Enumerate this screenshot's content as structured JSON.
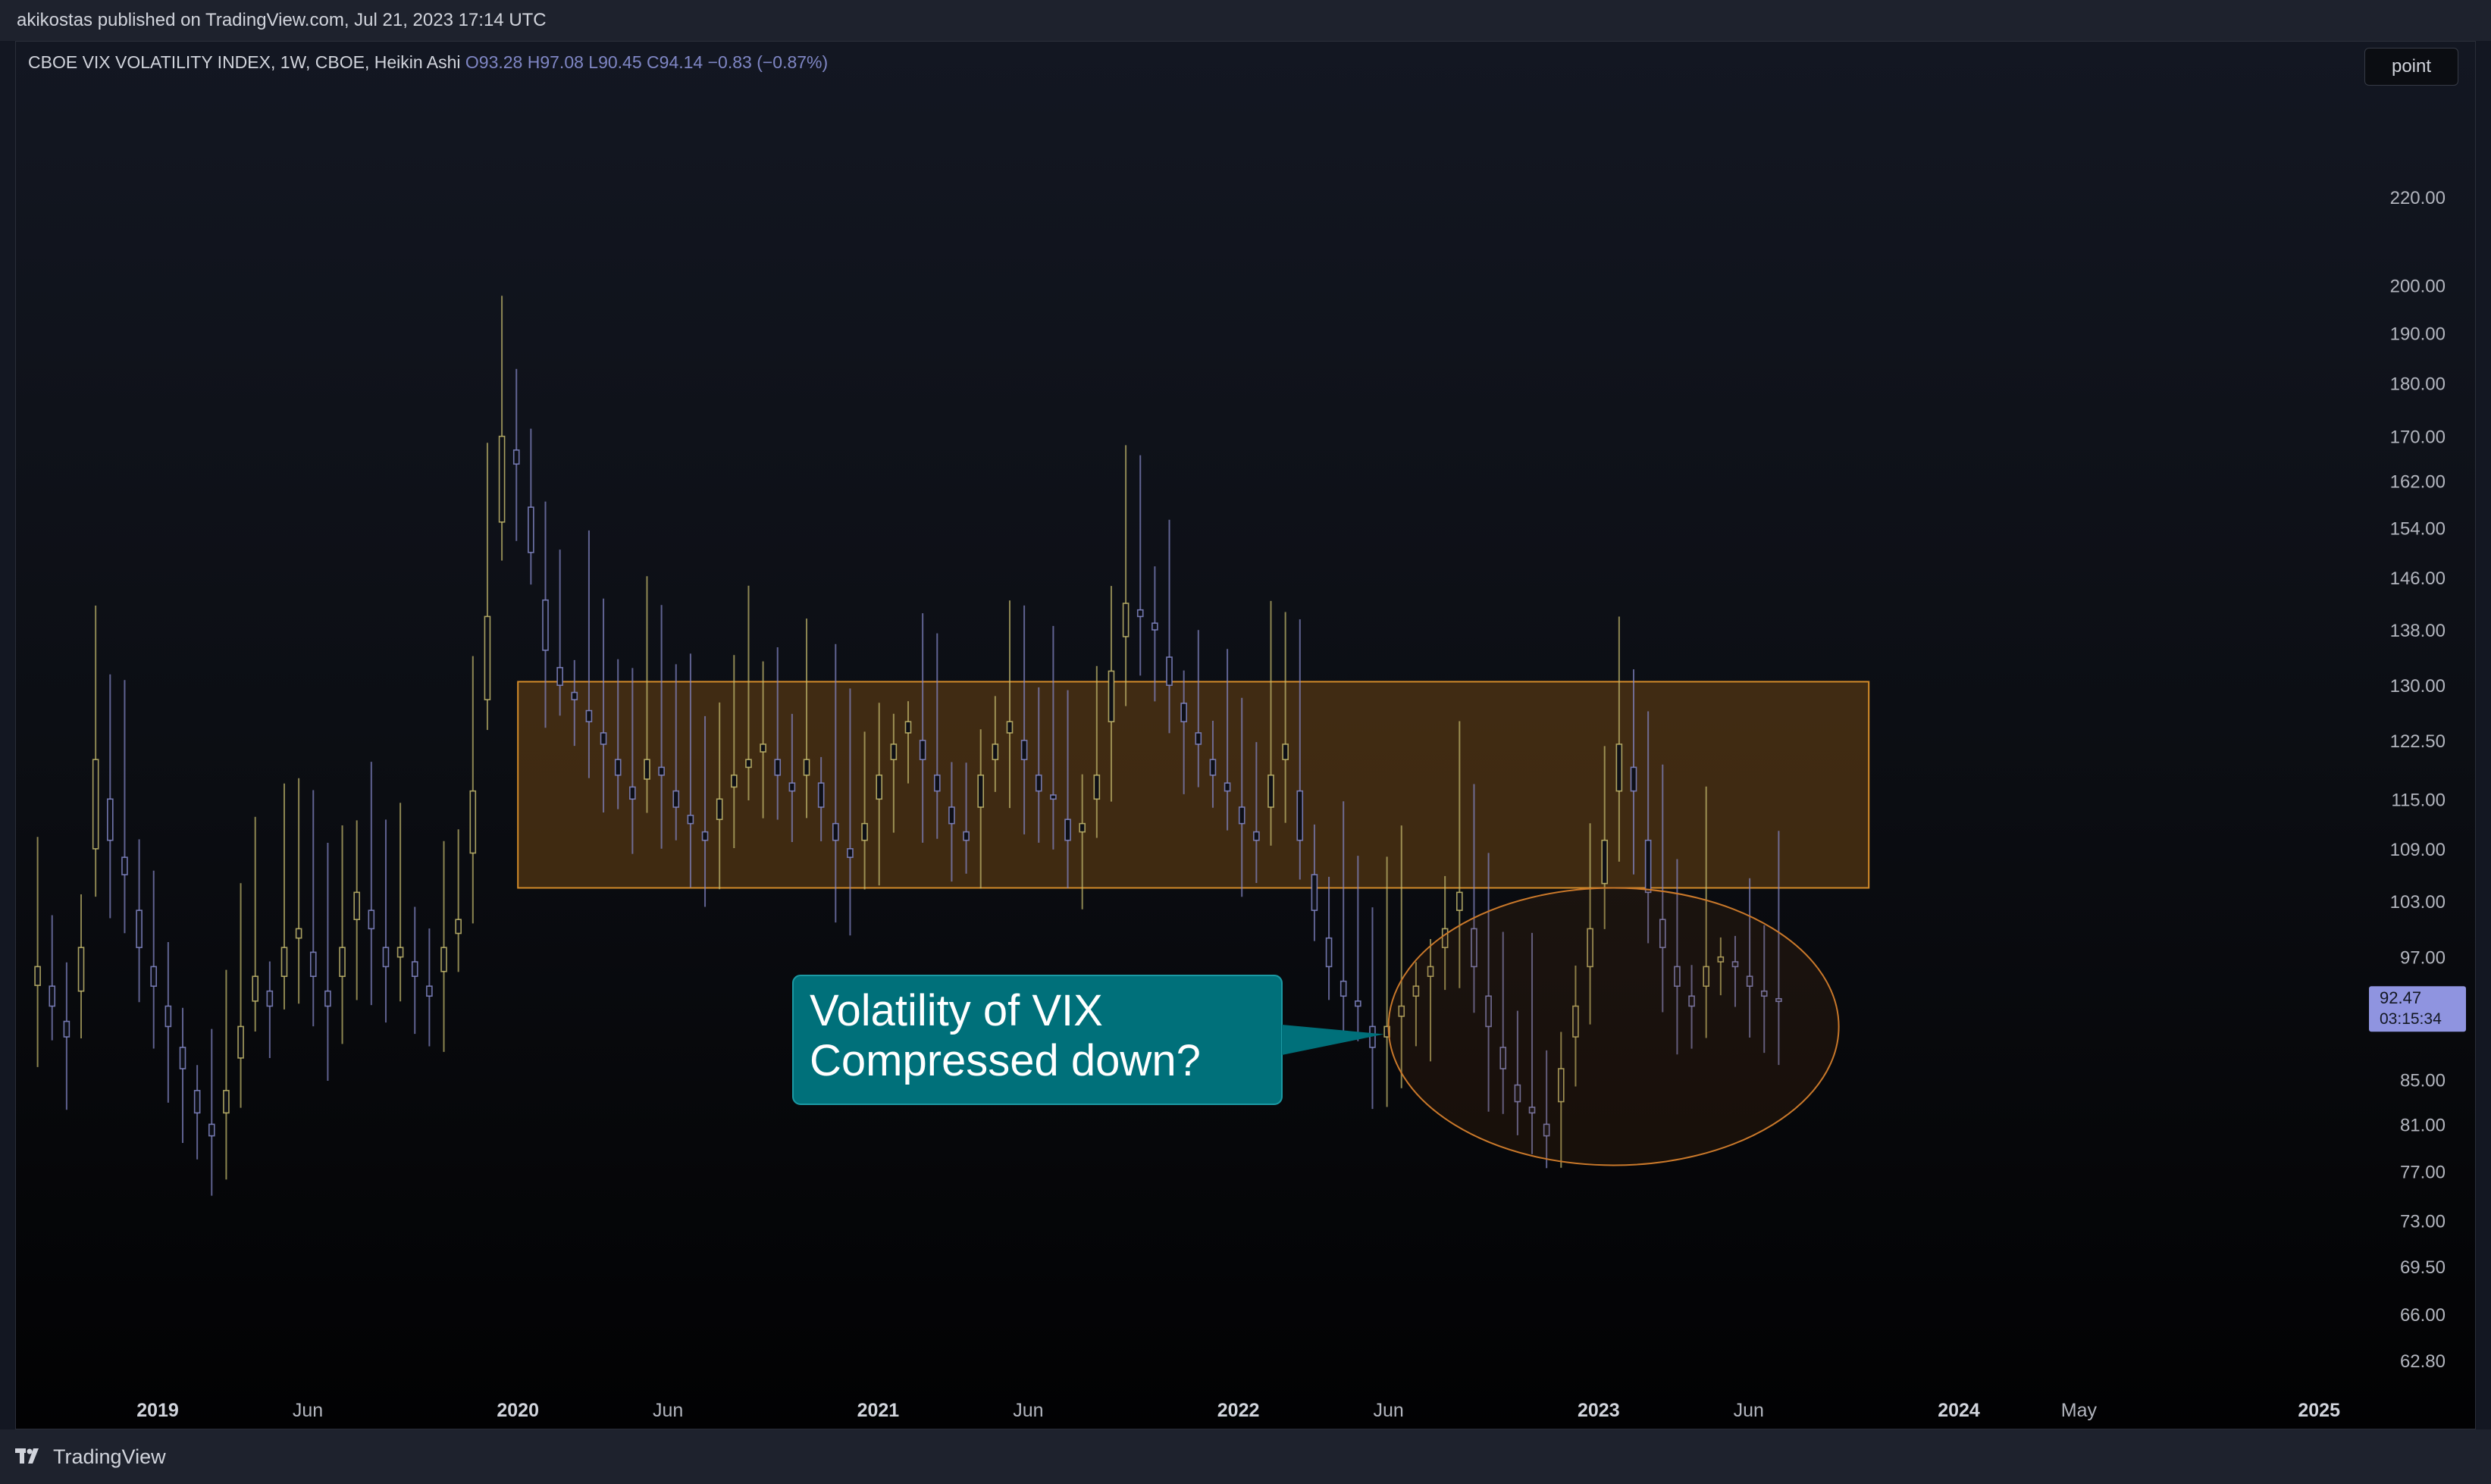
{
  "header": {
    "published_text": "akikostas published on TradingView.com, Jul 21, 2023 17:14 UTC"
  },
  "legend": {
    "symbol": "CBOE VIX VOLATILITY INDEX, 1W, CBOE, Heikin Ashi",
    "open": "O93.28",
    "high": "H97.08",
    "low": "L90.45",
    "close": "C94.14",
    "change": "−0.83 (−0.87%)"
  },
  "toolbar": {
    "point_label": "point"
  },
  "price_tag": {
    "value": "92.47",
    "countdown": "03:15:34"
  },
  "annotation": {
    "line1": "Volatility of VIX",
    "line2": "Compressed down?"
  },
  "footer": {
    "brand": "TradingView"
  },
  "colors": {
    "background": "#131722",
    "bull": "#c5bb6e",
    "bear": "#8488c8",
    "zone_fill": "#6b4413",
    "zone_border": "#d38b2a",
    "callout": "#00707a",
    "price_tag": "#8f94e0"
  },
  "chart_data": {
    "type": "candlestick",
    "style": "Heikin Ashi",
    "y_axis": {
      "scale": "log",
      "ticks": [
        "220.00",
        "200.00",
        "190.00",
        "180.00",
        "170.00",
        "162.00",
        "154.00",
        "146.00",
        "138.00",
        "130.00",
        "122.50",
        "115.00",
        "109.00",
        "103.00",
        "97.00",
        "85.00",
        "81.00",
        "77.00",
        "73.00",
        "69.50",
        "66.00",
        "62.80"
      ]
    },
    "x_axis": {
      "ticks": [
        "2019",
        "Jun",
        "2020",
        "Jun",
        "2021",
        "Jun",
        "2022",
        "Jun",
        "2023",
        "Jun",
        "2024",
        "May",
        "2025"
      ]
    },
    "zone": {
      "y_from": 104.5,
      "y_to": 130.5,
      "x_from": "2020-01",
      "x_to": "2023-10"
    },
    "ellipse": {
      "x_from": "2022-06",
      "x_to": "2023-09",
      "y_from": 77.5,
      "y_to": 104.5
    },
    "last_price": 92.47,
    "series": {
      "x_start": "2018-09",
      "x_end": "2023-07",
      "closes": [
        96,
        92,
        89,
        98,
        120,
        110,
        106,
        98,
        94,
        90,
        86,
        82,
        80,
        84,
        90,
        95,
        92,
        98,
        100,
        95,
        92,
        98,
        104,
        100,
        96,
        98,
        95,
        93,
        98,
        101,
        116,
        140,
        170,
        165,
        150,
        135,
        130,
        128,
        125,
        122,
        118,
        115,
        120,
        118,
        114,
        112,
        110,
        115,
        118,
        120,
        122,
        118,
        116,
        120,
        114,
        110,
        108,
        112,
        118,
        122,
        125,
        120,
        116,
        112,
        110,
        118,
        122,
        125,
        120,
        116,
        115,
        110,
        112,
        118,
        132,
        142,
        140,
        138,
        130,
        125,
        122,
        118,
        116,
        112,
        110,
        118,
        122,
        110,
        102,
        96,
        93,
        92,
        88,
        90,
        92,
        94,
        96,
        100,
        104,
        96,
        90,
        86,
        83,
        82,
        80,
        86,
        92,
        100,
        110,
        122,
        116,
        104,
        98,
        94,
        92,
        96,
        97,
        96,
        94,
        93,
        92.47
      ]
    }
  }
}
